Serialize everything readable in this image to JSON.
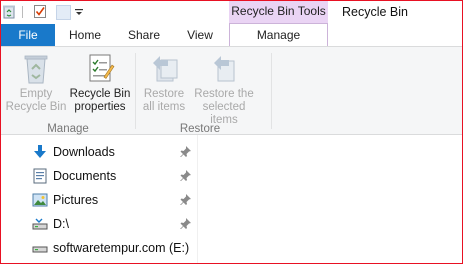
{
  "titlebar": {
    "context_group": "Recycle Bin Tools",
    "title": "Recycle Bin"
  },
  "tabs": {
    "file": "File",
    "home": "Home",
    "share": "Share",
    "view": "View",
    "manage": "Manage"
  },
  "ribbon": {
    "empty_l1": "Empty",
    "empty_l2": "Recycle Bin",
    "props_l1": "Recycle Bin",
    "props_l2": "properties",
    "restore_all_l1": "Restore",
    "restore_all_l2": "all items",
    "restore_sel_l1": "Restore the",
    "restore_sel_l2": "selected items",
    "group_manage": "Manage",
    "group_restore": "Restore"
  },
  "nav": {
    "items": [
      {
        "label": "Downloads",
        "icon": "download-arrow-icon",
        "pinned": true
      },
      {
        "label": "Documents",
        "icon": "documents-icon",
        "pinned": true
      },
      {
        "label": "Pictures",
        "icon": "pictures-icon",
        "pinned": true
      },
      {
        "label": "D:\\",
        "icon": "drive-icon",
        "pinned": true
      },
      {
        "label": "softwaretempur.com (E:)",
        "icon": "drive-icon",
        "pinned": false
      }
    ]
  },
  "colors": {
    "file_tab": "#1979ca",
    "context_group": "#ead4f4",
    "window_border": "#e81123"
  }
}
